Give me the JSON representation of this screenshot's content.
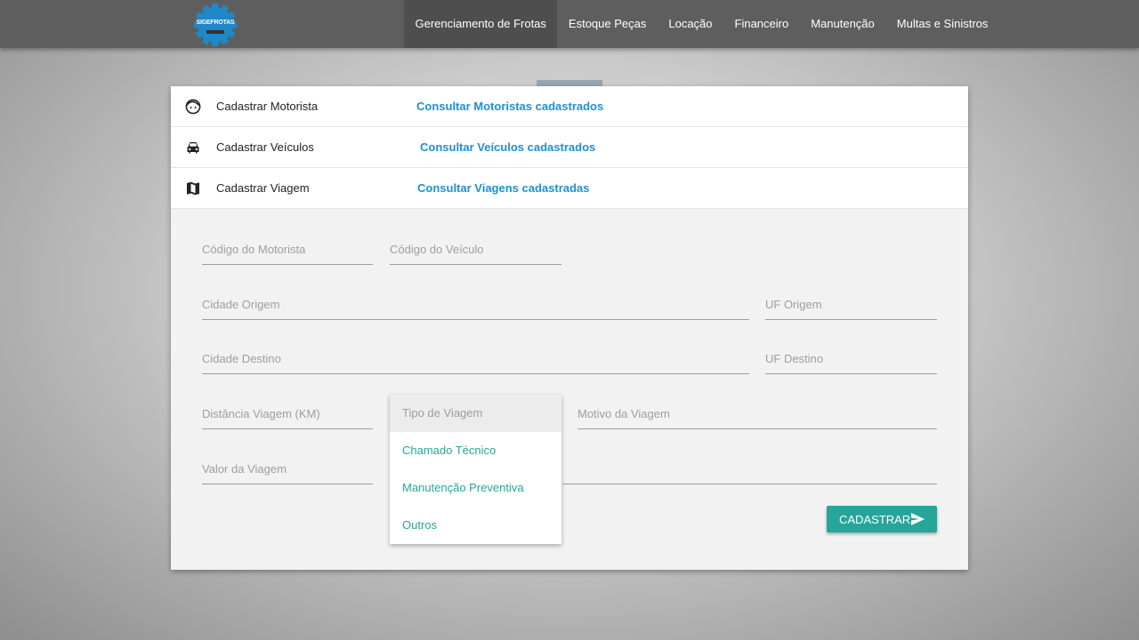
{
  "header": {
    "logo_text": "SIGEFROTAS",
    "nav": [
      {
        "label": "Gerenciamento de Frotas",
        "active": true
      },
      {
        "label": "Estoque Peças"
      },
      {
        "label": "Locação"
      },
      {
        "label": "Financeiro"
      },
      {
        "label": "Manutenção"
      },
      {
        "label": "Multas e Sinistros"
      }
    ]
  },
  "menu": {
    "rows": [
      {
        "icon": "face-icon",
        "label": "Cadastrar Motorista",
        "link": "Consultar Motoristas cadastrados"
      },
      {
        "icon": "car-icon",
        "label": "Cadastrar Veículos",
        "link": "Consultar Veículos cadastrados"
      },
      {
        "icon": "map-icon",
        "label": "Cadastrar Viagem",
        "link": "Consultar Viagens cadastradas"
      }
    ]
  },
  "form": {
    "codigo_motorista": {
      "placeholder": "Código do Motorista",
      "value": ""
    },
    "codigo_veiculo": {
      "placeholder": "Código do Veículo",
      "value": ""
    },
    "cidade_origem": {
      "placeholder": "Cidade Origem",
      "value": ""
    },
    "uf_origem": {
      "placeholder": "UF Origem",
      "value": ""
    },
    "cidade_destino": {
      "placeholder": "Cidade Destino",
      "value": ""
    },
    "uf_destino": {
      "placeholder": "UF Destino",
      "value": ""
    },
    "distancia": {
      "placeholder": "Distância Viagem (KM)",
      "value": ""
    },
    "motivo": {
      "placeholder": "Motivo da Viagem",
      "value": ""
    },
    "valor": {
      "placeholder": "Valor da Viagem",
      "value": ""
    },
    "tipo_viagem": {
      "placeholder": "Tipo de Viagem",
      "options": [
        "Chamado Técnico",
        "Manutenção Preventiva",
        "Outros"
      ]
    },
    "submit_label": "CADASTRAR"
  },
  "colors": {
    "accent": "#26a69a",
    "link": "#1e8fd6",
    "navbar": "#5e5e5e",
    "logo_gear": "#1e88c8"
  }
}
